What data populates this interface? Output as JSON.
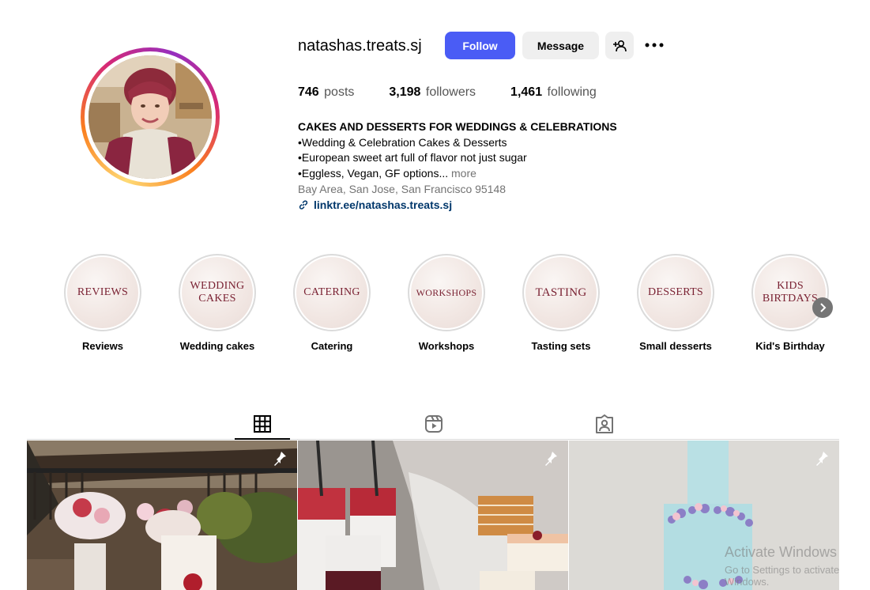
{
  "profile": {
    "username": "natashas.treats.sj",
    "follow_label": "Follow",
    "message_label": "Message",
    "add_user_icon": "add-user-icon",
    "more_icon": "more-options-icon"
  },
  "stats": {
    "posts_count": "746",
    "posts_label": "posts",
    "followers_count": "3,198",
    "followers_label": "followers",
    "following_count": "1,461",
    "following_label": "following"
  },
  "bio": {
    "title": "CAKES AND DESSERTS FOR WEDDINGS & CELEBRATIONS",
    "line1": "•Wedding & Celebration Cakes & Desserts",
    "line2": "•European sweet art full of flavor not just sugar",
    "line3": "•Eggless, Vegan, GF options...",
    "more": "more",
    "location": "Bay Area, San Jose, San Francisco 95148",
    "link": "linktr.ee/natashas.treats.sj"
  },
  "highlights": [
    {
      "cover": "REVIEWS",
      "label": "Reviews"
    },
    {
      "cover": "WEDDING CAKES",
      "label": "Wedding cakes"
    },
    {
      "cover": "CATERING",
      "label": "Catering"
    },
    {
      "cover": "WORKSHOPS",
      "label": "Workshops"
    },
    {
      "cover": "TASTING",
      "label": "Tasting sets"
    },
    {
      "cover": "DESSERTS",
      "label": "Small desserts"
    },
    {
      "cover": "KIDS BIRTDAYS",
      "label": "Kid's Birthday"
    }
  ],
  "tabs": [
    {
      "icon": "grid-icon",
      "active": true
    },
    {
      "icon": "reels-icon",
      "active": false
    },
    {
      "icon": "tagged-icon",
      "active": false
    }
  ],
  "posts": [
    {
      "subject": "wedding dessert table with flowers",
      "pinned": true
    },
    {
      "subject": "verrine desserts and cake slices",
      "pinned": true
    },
    {
      "subject": "light blue tiered wedding cake with flowers",
      "pinned": true
    }
  ],
  "watermark": {
    "line1": "Activate Windows",
    "line2": "Go to Settings to activate Windows."
  },
  "colors": {
    "accent": "#4a5cf5",
    "link": "#00376b",
    "muted": "#737373",
    "highlight_text": "#7a2233"
  }
}
